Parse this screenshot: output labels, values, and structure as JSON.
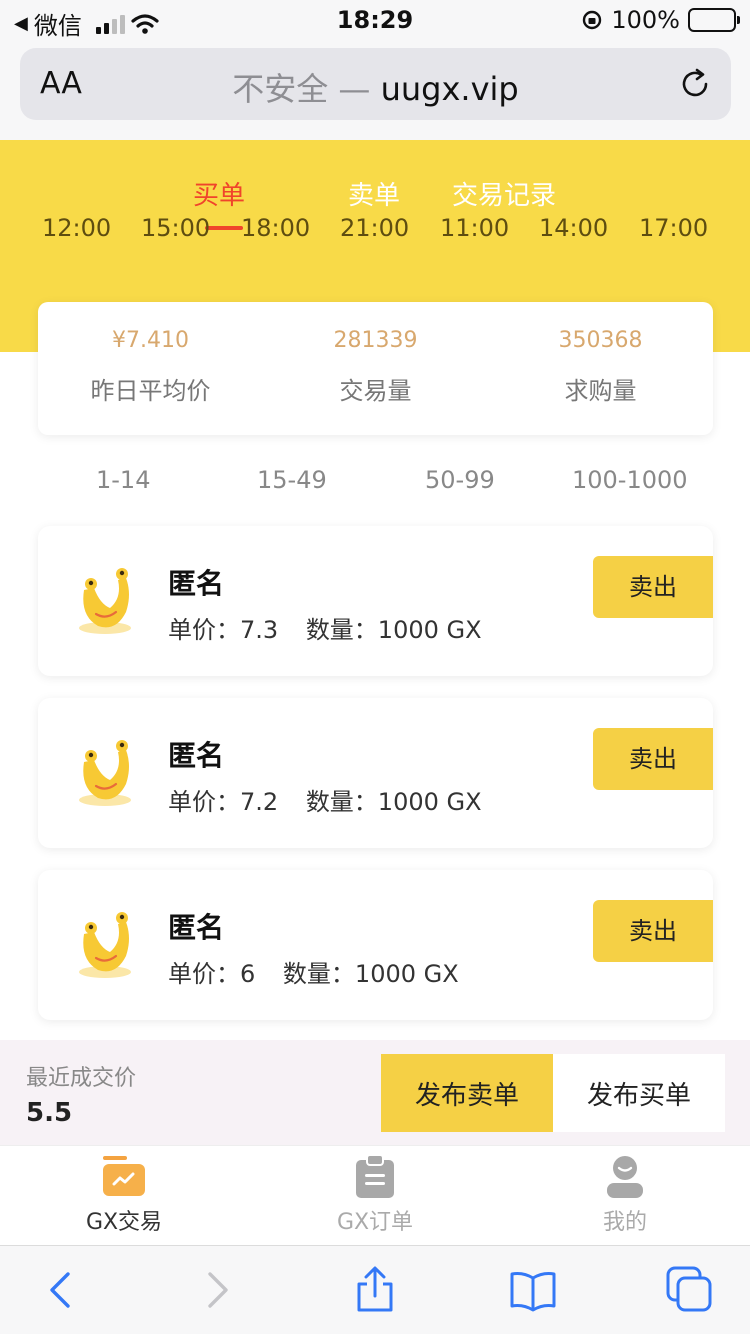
{
  "status_bar": {
    "carrier": "微信",
    "time": "18:29",
    "battery": "100%"
  },
  "browser": {
    "text_size": "AA",
    "url_prefix": "不安全 —",
    "url_domain": "uugx.vip"
  },
  "tabs": [
    {
      "label": "买单",
      "active": true
    },
    {
      "label": "卖单",
      "active": false
    },
    {
      "label": "交易记录",
      "active": false
    }
  ],
  "times": [
    "12:00",
    "15:00",
    "18:00",
    "21:00",
    "11:00",
    "14:00",
    "17:00"
  ],
  "stats": [
    {
      "value": "¥7.410",
      "label": "昨日平均价"
    },
    {
      "value": "281339",
      "label": "交易量"
    },
    {
      "value": "350368",
      "label": "求购量"
    }
  ],
  "ranges": [
    "1-14",
    "15-49",
    "50-99",
    "100-1000"
  ],
  "orders": [
    {
      "name": "匿名",
      "price_text": "单价：7.3",
      "qty_text": "数量：1000 GX",
      "action": "卖出"
    },
    {
      "name": "匿名",
      "price_text": "单价：7.2",
      "qty_text": "数量：1000 GX",
      "action": "卖出"
    },
    {
      "name": "匿名",
      "price_text": "单价：6",
      "qty_text": "数量：1000 GX",
      "action": "卖出"
    }
  ],
  "bottom": {
    "recent_label": "最近成交价",
    "recent_value": "5.5",
    "publish_sell": "发布卖单",
    "publish_buy": "发布买单"
  },
  "nav": [
    {
      "label": "GX交易",
      "icon": "chart-card-icon",
      "active": true
    },
    {
      "label": "GX订单",
      "icon": "clipboard-icon",
      "active": false
    },
    {
      "label": "我的",
      "icon": "user-icon",
      "active": false
    }
  ],
  "colors": {
    "brand_yellow": "#f8da48",
    "button_yellow": "#f5d045",
    "active_red": "#f0442b",
    "stat_orange": "#d8a86e",
    "ios_blue": "#3478f6"
  }
}
